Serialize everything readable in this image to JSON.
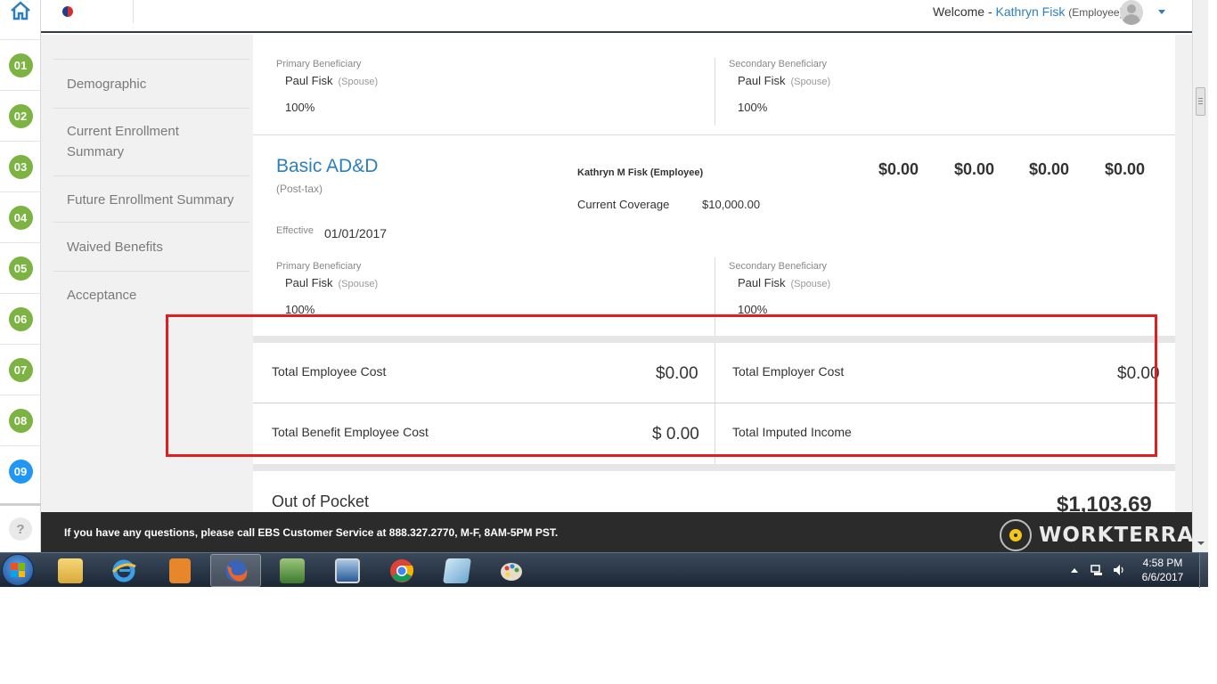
{
  "header": {
    "welcome_prefix": "Welcome -",
    "user_name": "Kathryn Fisk",
    "user_role": "(Employee)"
  },
  "steps": [
    "01",
    "02",
    "03",
    "04",
    "05",
    "06",
    "07",
    "08",
    "09"
  ],
  "current_step": "09",
  "help_label": "?",
  "sidebar": {
    "items": [
      {
        "label": "Demographic"
      },
      {
        "label": "Current Enrollment Summary"
      },
      {
        "label": "Future Enrollment Summary"
      },
      {
        "label": "Waived Benefits"
      },
      {
        "label": "Acceptance"
      }
    ]
  },
  "prev_benefit": {
    "primary": {
      "label": "Primary Beneficiary",
      "name": "Paul Fisk",
      "relation": "(Spouse)",
      "percent": "100%"
    },
    "secondary": {
      "label": "Secondary Beneficiary",
      "name": "Paul Fisk",
      "relation": "(Spouse)",
      "percent": "100%"
    }
  },
  "basic_add": {
    "title": "Basic AD&D",
    "tax": "(Post-tax)",
    "covered": "Kathryn M Fisk (Employee)",
    "coverage_label": "Current Coverage",
    "coverage_value": "$10,000.00",
    "amounts": [
      "$0.00",
      "$0.00",
      "$0.00",
      "$0.00"
    ],
    "effective_label": "Effective",
    "effective_date": "01/01/2017",
    "primary": {
      "label": "Primary Beneficiary",
      "name": "Paul Fisk",
      "relation": "(Spouse)",
      "percent": "100%"
    },
    "secondary": {
      "label": "Secondary Beneficiary",
      "name": "Paul Fisk",
      "relation": "(Spouse)",
      "percent": "100%"
    }
  },
  "totals": {
    "employee_cost_label": "Total Employee Cost",
    "employee_cost_value": "$0.00",
    "employer_cost_label": "Total Employer Cost",
    "employer_cost_value": "$0.00",
    "benefit_employee_cost_label": "Total Benefit Employee Cost",
    "benefit_employee_cost_value": "$ 0.00",
    "imputed_income_label": "Total Imputed Income"
  },
  "out_of_pocket": {
    "label": "Out of Pocket",
    "value": "$1,103.69"
  },
  "footer": {
    "help_text": "If you have any questions, please call EBS Customer Service at 888.327.2770, M-F, 8AM-5PM PST.",
    "brand": "WORKTERRA"
  },
  "taskbar": {
    "time": "4:58 PM",
    "date": "6/6/2017",
    "apps": [
      "file-explorer-icon",
      "internet-explorer-icon",
      "media-player-icon",
      "firefox-icon",
      "excel-icon",
      "remote-desktop-icon",
      "chrome-icon",
      "notepad-icon",
      "paint-icon"
    ]
  },
  "colors": {
    "accent_blue": "#2c7fbf",
    "step_green": "#7cb342",
    "step_current": "#2196f3",
    "highlight_red": "#e01e1e",
    "footer_bg": "#2b2b2b"
  }
}
